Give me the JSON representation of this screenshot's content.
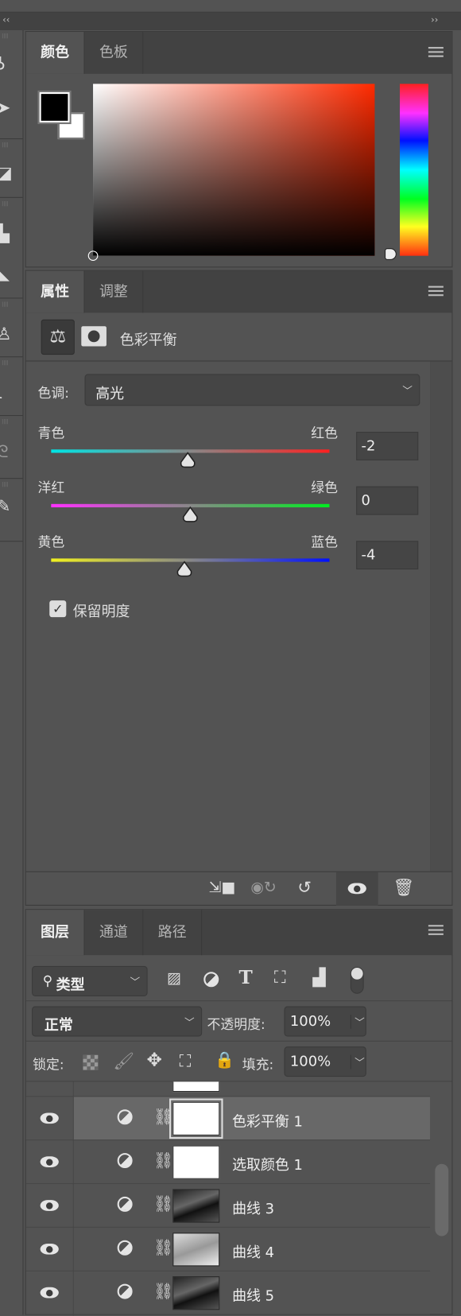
{
  "collapse": {
    "left": "‹‹",
    "right": "››"
  },
  "color_panel": {
    "tabs": [
      {
        "label": "颜色",
        "active": true
      },
      {
        "label": "色板",
        "active": false
      }
    ],
    "foreground": "#000000",
    "background": "#ffffff",
    "hue": "#ff2a00"
  },
  "properties_panel": {
    "tabs": [
      {
        "label": "属性",
        "active": true
      },
      {
        "label": "调整",
        "active": false
      }
    ],
    "title": "色彩平衡",
    "tone_label": "色调:",
    "tone_value": "高光",
    "sliders": [
      {
        "left": "青色",
        "right": "红色",
        "value": "-2",
        "num": -2,
        "range": [
          -100,
          100
        ],
        "colors": [
          "#00e5e5",
          "#ff2020"
        ]
      },
      {
        "left": "洋红",
        "right": "绿色",
        "value": "0",
        "num": 0,
        "range": [
          -100,
          100
        ],
        "colors": [
          "#ff30ff",
          "#00ee20"
        ]
      },
      {
        "left": "黄色",
        "right": "蓝色",
        "value": "-4",
        "num": -4,
        "range": [
          -100,
          100
        ],
        "colors": [
          "#f0f020",
          "#0010ff"
        ]
      }
    ],
    "preserve_luminosity": {
      "label": "保留明度",
      "checked": true
    },
    "footer_icons": [
      "clip-to-layer-icon",
      "view-previous-icon",
      "reset-icon",
      "visibility-icon",
      "trash-icon"
    ]
  },
  "layers_panel": {
    "tabs": [
      {
        "label": "图层",
        "active": true
      },
      {
        "label": "通道",
        "active": false
      },
      {
        "label": "路径",
        "active": false
      }
    ],
    "filter": {
      "label": "类型"
    },
    "blend_mode": "正常",
    "opacity_label": "不透明度:",
    "opacity": "100%",
    "lock_label": "锁定:",
    "fill_label": "填充:",
    "fill": "100%",
    "layers": [
      {
        "name": "色彩平衡 1",
        "selected": true,
        "thumb": "white"
      },
      {
        "name": "选取颜色 1",
        "selected": false,
        "thumb": "white"
      },
      {
        "name": "曲线 3",
        "selected": false,
        "thumb": "dark"
      },
      {
        "name": "曲线 4",
        "selected": false,
        "thumb": "light"
      },
      {
        "name": "曲线 5",
        "selected": false,
        "thumb": "dark"
      }
    ]
  }
}
